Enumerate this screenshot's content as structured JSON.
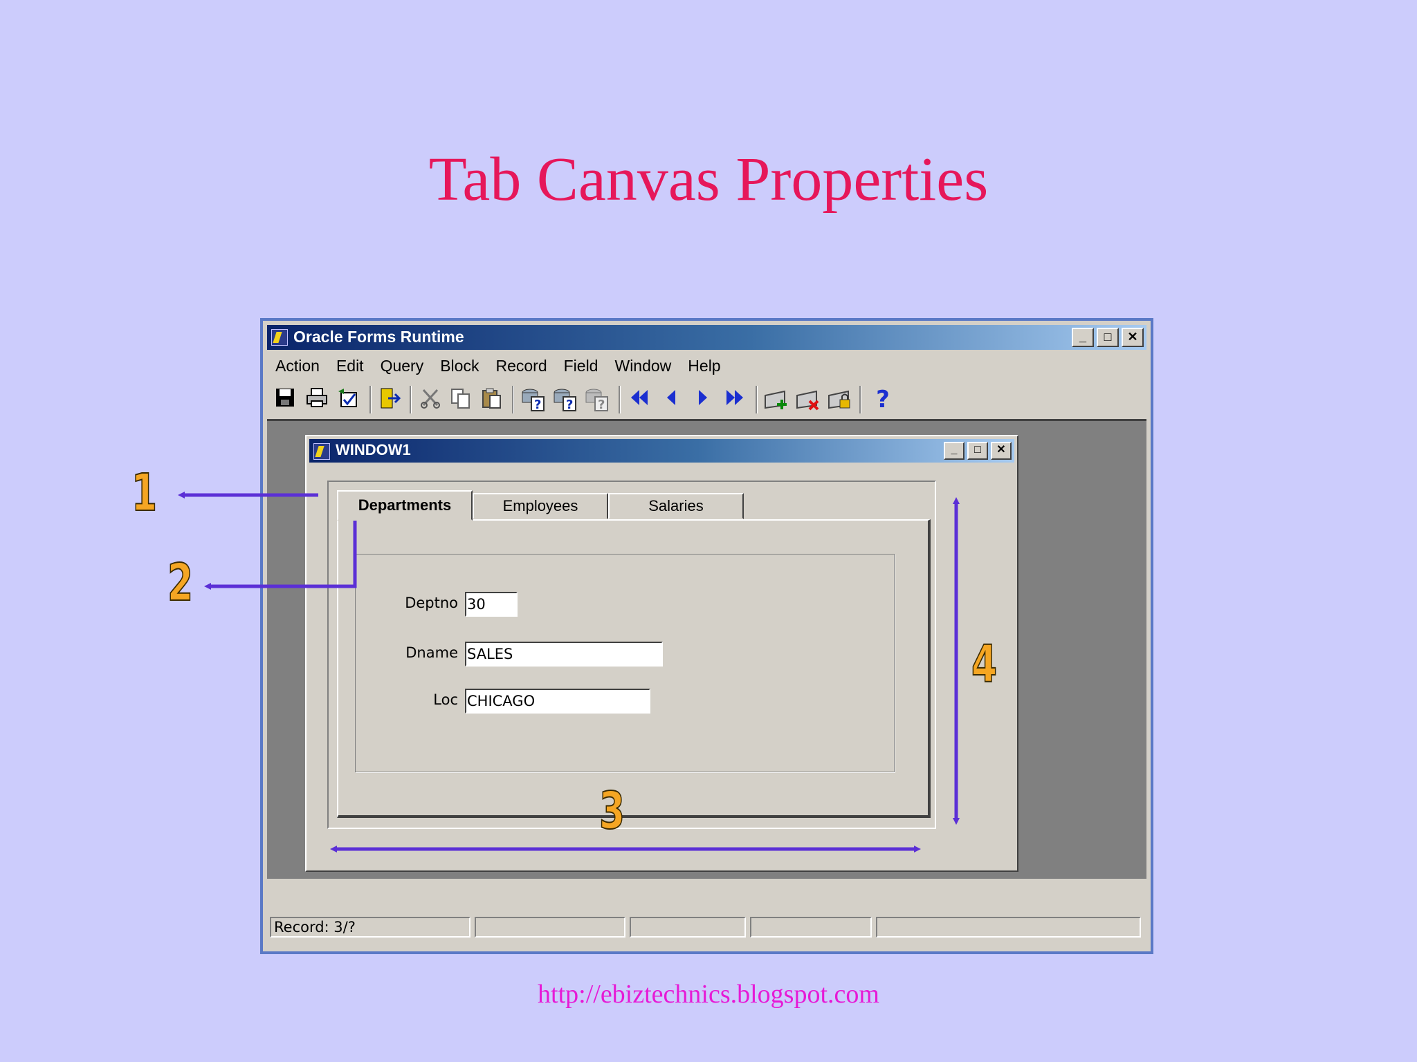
{
  "slide": {
    "title": "Tab Canvas Properties",
    "footer": "http://ebiztechnics.blogspot.com"
  },
  "app": {
    "title": "Oracle Forms Runtime",
    "window_buttons": {
      "minimize": "_",
      "maximize": "□",
      "close": "✕"
    },
    "menu": [
      "Action",
      "Edit",
      "Query",
      "Block",
      "Record",
      "Field",
      "Window",
      "Help"
    ],
    "toolbar_icons": [
      "save-icon",
      "print-icon",
      "clear-form-icon",
      "exit-icon",
      "cut-icon",
      "copy-icon",
      "paste-icon",
      "enter-query-icon",
      "execute-query-icon",
      "cancel-query-icon",
      "first-record-icon",
      "previous-record-icon",
      "next-record-icon",
      "last-record-icon",
      "insert-record-icon",
      "delete-record-icon",
      "lock-record-icon",
      "help-icon"
    ],
    "status": {
      "record": "Record: 3/?",
      "field2": "",
      "field3": "",
      "field4": "",
      "field5": ""
    }
  },
  "window1": {
    "title": "WINDOW1",
    "tabs": [
      {
        "label": "Departments",
        "active": true
      },
      {
        "label": "Employees",
        "active": false
      },
      {
        "label": "Salaries",
        "active": false
      }
    ],
    "fields": {
      "deptno": {
        "label": "Deptno",
        "value": "30"
      },
      "dname": {
        "label": "Dname",
        "value": "SALES"
      },
      "loc": {
        "label": "Loc",
        "value": "CHICAGO"
      }
    }
  },
  "annotations": {
    "n1": "1",
    "n2": "2",
    "n3": "3",
    "n4": "4"
  },
  "colors": {
    "background": "#ccccfc",
    "title": "#e6175a",
    "footer": "#e61ad6",
    "arrow": "#5b2fd6",
    "number": "#f5a623"
  }
}
